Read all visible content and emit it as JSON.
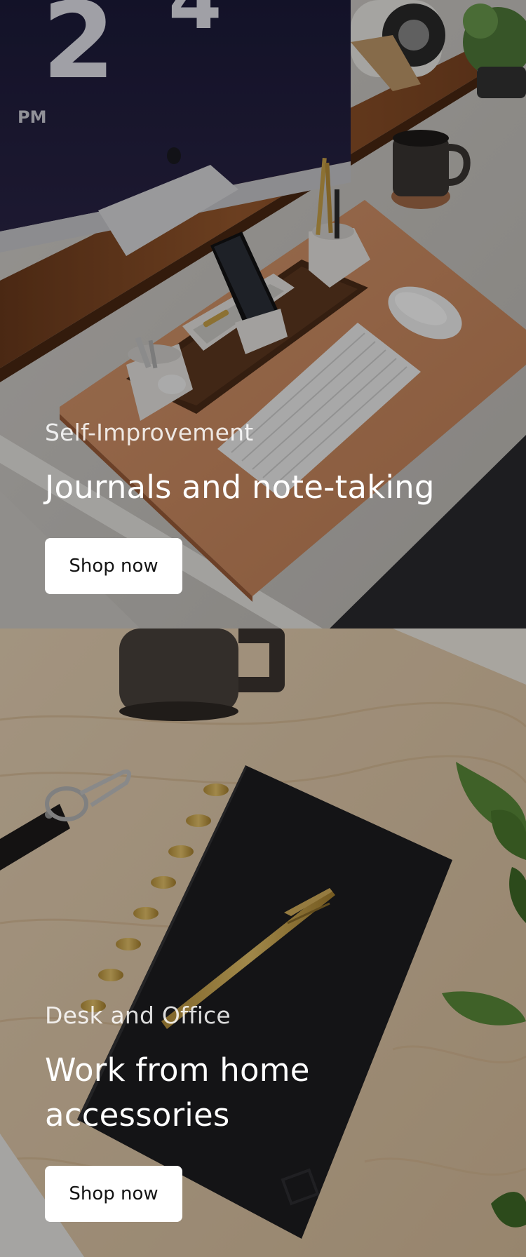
{
  "promos": [
    {
      "eyebrow": "Self-Improvement",
      "headline": "Journals and note-taking",
      "button_label": "Shop now",
      "image_subject": "desk setup with iMac, wooden shelf, leather desk mat, keyboard, mouse, phone stand and pen holders"
    },
    {
      "eyebrow": "Desk and Office",
      "headline": "Work from home accessories",
      "button_label": "Shop now",
      "image_subject": "black disc-bound notebook with brass pen on a maple desk, coffee mug, leather keychain and plant"
    }
  ],
  "colors": {
    "overlay": "#000000",
    "button_bg": "#ffffff",
    "button_text": "#141414",
    "text": "#ffffff"
  }
}
